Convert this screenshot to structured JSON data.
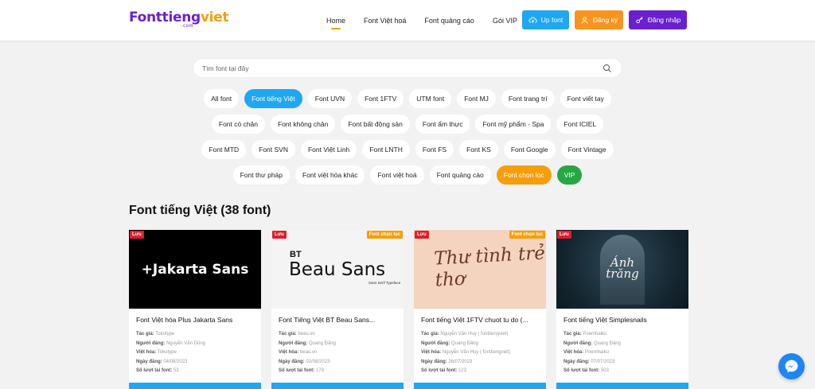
{
  "logo": {
    "main_a": "Fonttieng",
    "main_b": "viet",
    "sub": ".com"
  },
  "nav": {
    "items": [
      "Home",
      "Font Việt hoá",
      "Font quảng cáo",
      "Gói VIP"
    ]
  },
  "buttons": {
    "upload": "Up font",
    "register": "Đăng ký",
    "login": "Đăng nhập"
  },
  "search": {
    "placeholder": "Tìm font tại đây"
  },
  "categories": {
    "rows": [
      [
        "All font",
        "Font tiếng Việt",
        "Font UVN",
        "Font 1FTV",
        "UTM font",
        "Font MJ",
        "Font trang trí",
        "Font viết tay"
      ],
      [
        "Font có chân",
        "Font không chân",
        "Font bất động sản",
        "Font ẩm thực",
        "Font mỹ phẩm - Spa",
        "Font ICIEL"
      ],
      [
        "Font MTD",
        "Font SVN",
        "Font Việt Linh",
        "Font LNTH",
        "Font FS",
        "Font KS",
        "Font Google",
        "Font Vintage"
      ],
      [
        "Font thư pháp",
        "Font việt hóa khác",
        "Font việt hoá",
        "Font quảng cáo",
        "Font chọn lọc",
        "VIP"
      ]
    ],
    "active": "Font tiếng Việt",
    "highlight_orange": "Font chọn lọc",
    "highlight_green": "VIP"
  },
  "section": {
    "title": "Font tiếng Việt (38 font)"
  },
  "labels": {
    "author": "Tác giả:",
    "poster": "Người đăng:",
    "localizer": "Việt hóa:",
    "date": "Ngày đăng:",
    "downloads": "Số lượt tải font:",
    "save_badge": "Lưu",
    "selected_badge": "Font chọn lọc"
  },
  "cards": [
    {
      "thumb_text": "+Jakarta Sans",
      "title": "Font Việt hóa Plus Jakarta Sans",
      "author": "Tokotype",
      "poster": "Nguyễn Văn Dũng",
      "localizer": "Tokotype",
      "date": "04/08/2023",
      "downloads": "53",
      "selected": false
    },
    {
      "thumb_text": "Beau Sans",
      "thumb_prefix": "BT",
      "thumb_small": "Sans Serif Typeface",
      "title": "Font Tiếng Việt BT Beau Sans...",
      "author": "beau.vn",
      "poster": "Quang Đăng",
      "localizer": "beau.vn",
      "date": "02/08/2023",
      "downloads": "178",
      "selected": true
    },
    {
      "thumb_text": "Thư tình trẻ thơ",
      "title": "Font tiếng Việt 1FTV chuot tu do (...",
      "author": "Nguyễn Văn Huy ( fonttiengviet)",
      "poster": "Quang Đăng",
      "localizer": "Nguyễn Văn Huy ( fonttiengviet)",
      "date": "26/07/2023",
      "downloads": "123",
      "selected": true
    },
    {
      "thumb_text": "Ánh trăng",
      "title": "Font tiếng Việt Simplesnails",
      "author": "Poemhaiku",
      "poster": "Quang Đăng",
      "localizer": "Poemhaiku",
      "date": "07/07/2023",
      "downloads": "503",
      "selected": false
    }
  ],
  "colors": {
    "brand_purple": "#6a1fd1",
    "brand_orange": "#f59e0b",
    "accent_blue": "#1ea7f2",
    "green": "#27a744",
    "red": "#e11d2b"
  }
}
